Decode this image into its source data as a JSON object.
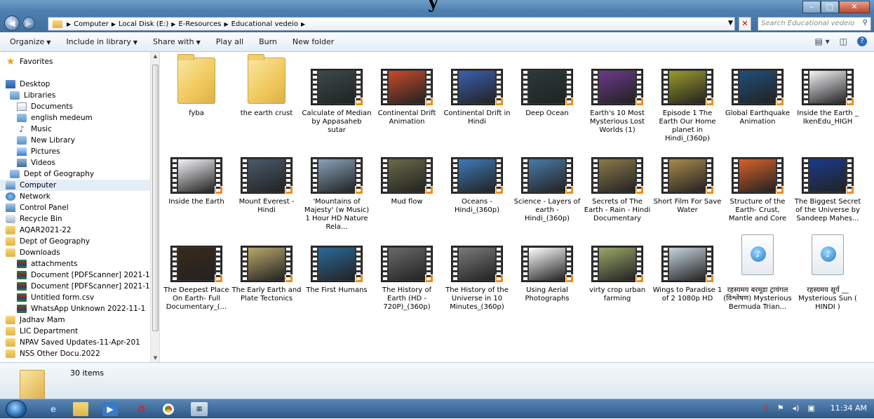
{
  "page_title": "y",
  "window": {
    "minimize": "–",
    "maximize": "□",
    "close": "✕"
  },
  "address": {
    "crumbs": [
      "Computer",
      "Local Disk (E:)",
      "E-Resources",
      "Educational vedeio"
    ],
    "search_placeholder": "Search Educational vedeio"
  },
  "toolbar": {
    "organize": "Organize",
    "include_in_library": "Include in library",
    "share_with": "Share with",
    "play_all": "Play all",
    "burn": "Burn",
    "new_folder": "New folder"
  },
  "nav": {
    "items": [
      {
        "label": "Favorites",
        "icon": "star-icon"
      },
      {
        "label": "Desktop",
        "icon": "desktop-icon"
      },
      {
        "label": "Libraries",
        "icon": "library-icon"
      },
      {
        "label": "Documents",
        "icon": "documents-icon"
      },
      {
        "label": "english medeum",
        "icon": "library-icon"
      },
      {
        "label": "Music",
        "icon": "music-icon"
      },
      {
        "label": "New Library",
        "icon": "library-icon"
      },
      {
        "label": "Pictures",
        "icon": "pictures-icon"
      },
      {
        "label": "Videos",
        "icon": "videos-icon"
      },
      {
        "label": "Dept of Geography",
        "icon": "library-icon"
      },
      {
        "label": "Computer",
        "icon": "computer-icon"
      },
      {
        "label": "Network",
        "icon": "network-icon"
      },
      {
        "label": "Control Panel",
        "icon": "control-panel-icon"
      },
      {
        "label": "Recycle Bin",
        "icon": "recycle-bin-icon"
      },
      {
        "label": "AQAR2021-22",
        "icon": "folder-icon"
      },
      {
        "label": "Dept of Geography",
        "icon": "folder-icon"
      },
      {
        "label": "Downloads",
        "icon": "folder-icon"
      },
      {
        "label": "attachments",
        "icon": "file-icon"
      },
      {
        "label": "Document [PDFScanner] 2021-1",
        "icon": "file-icon"
      },
      {
        "label": "Document [PDFScanner] 2021-1",
        "icon": "file-icon"
      },
      {
        "label": "Untitled form.csv",
        "icon": "file-icon"
      },
      {
        "label": "WhatsApp Unknown 2022-11-1",
        "icon": "file-icon"
      },
      {
        "label": "Jadhav Mam",
        "icon": "folder-icon"
      },
      {
        "label": "LIC Department",
        "icon": "folder-icon"
      },
      {
        "label": "NPAV Saved Updates-11-Apr-201",
        "icon": "folder-icon"
      },
      {
        "label": "NSS Other Docu.2022",
        "icon": "folder-icon"
      }
    ]
  },
  "files": [
    {
      "name": "fyba",
      "type": "folder"
    },
    {
      "name": "the earth crust",
      "type": "folder"
    },
    {
      "name": "Calculate of Median by Appasaheb sutar",
      "type": "video",
      "scene": "#3a4a4a"
    },
    {
      "name": "Continental Drift Animation",
      "type": "video",
      "scene": "#c84a2a"
    },
    {
      "name": "Continental Drift in Hindi",
      "type": "video",
      "scene": "#3b5fb0"
    },
    {
      "name": "Deep Ocean",
      "type": "video",
      "scene": "#2a3a3a"
    },
    {
      "name": "Earth's 10 Most Mysterious Lost Worlds (1)",
      "type": "video",
      "scene": "#6a3a8a"
    },
    {
      "name": "Episode 1 The Earth Our Home planet in Hindi_(360p)",
      "type": "video",
      "scene": "#9a9a2a"
    },
    {
      "name": "Global Earthquake Animation",
      "type": "video",
      "scene": "#1f4f7a"
    },
    {
      "name": "Inside the Earth _ IkenEdu_HIGH",
      "type": "video",
      "scene": "#f4f4f8"
    },
    {
      "name": "Inside the Earth",
      "type": "video",
      "scene": "#f4f4f8"
    },
    {
      "name": "Mount Everest - Hindi",
      "type": "video",
      "scene": "#4a5a6a"
    },
    {
      "name": "'Mountains of Majesty' (w Music) 1 Hour HD Nature Rela...",
      "type": "video",
      "scene": "#8aa2b8"
    },
    {
      "name": "Mud flow",
      "type": "video",
      "scene": "#6a6a4a"
    },
    {
      "name": "Oceans - Hindi_(360p)",
      "type": "video",
      "scene": "#3f7ab8"
    },
    {
      "name": "Science - Layers of earth - Hindi_(360p)",
      "type": "video",
      "scene": "#4a7aa8"
    },
    {
      "name": "Secrets of The Earth - Rain - Hindi Documentary",
      "type": "video",
      "scene": "#8a7a4a"
    },
    {
      "name": "Short Film For Save Water",
      "type": "video",
      "scene": "#a88a4a"
    },
    {
      "name": "Structure of the Earth- Crust, Mantle and Core",
      "type": "video",
      "scene": "#d8602a"
    },
    {
      "name": "The Biggest Secret of the Universe by Sandeep Mahes...",
      "type": "video",
      "scene": "#1a3a8a"
    },
    {
      "name": "The Deepest Place On Earth- Full Documentary_(...",
      "type": "video",
      "scene": "#3a2a1a"
    },
    {
      "name": "The Early Earth and Plate Tectonics",
      "type": "video",
      "scene": "#b8a86a"
    },
    {
      "name": "The First Humans",
      "type": "video",
      "scene": "#2a6a9a"
    },
    {
      "name": "The History of Earth (HD - 720P)_(360p)",
      "type": "video",
      "scene": "#6a6a6a"
    },
    {
      "name": "The History of the Universe in 10 Minutes_(360p)",
      "type": "video",
      "scene": "#7a7a7a"
    },
    {
      "name": "Using Aerial Photographs",
      "type": "video",
      "scene": "#ffffff"
    },
    {
      "name": "virty crop urban farming",
      "type": "video",
      "scene": "#9aa86a"
    },
    {
      "name": "Wings to Paradise 1 of 2 1080p HD",
      "type": "video",
      "scene": "#c8d4e0"
    },
    {
      "name": "रहस्यमय बरमूडा ट्रायंगल (विश्लेषण) Mysterious Bermuda Trian...",
      "type": "audio"
    },
    {
      "name": "रहस्यमय सूर्य __ Mysterious Sun ( HINDI )",
      "type": "audio"
    }
  ],
  "details": {
    "count": "30 items"
  },
  "taskbar": {
    "time": "11:34 AM"
  }
}
